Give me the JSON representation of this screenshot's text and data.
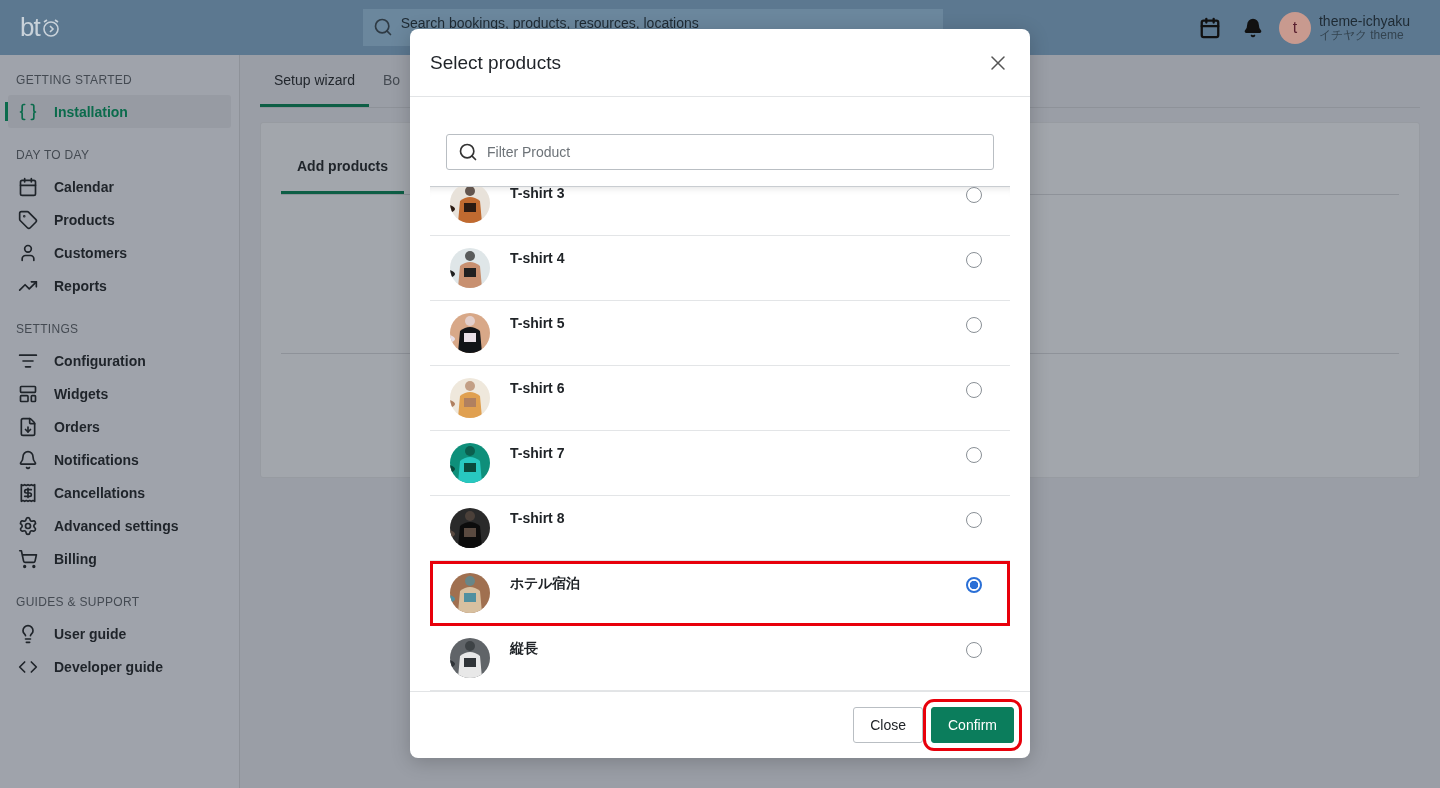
{
  "header": {
    "logo": "bt",
    "search": {
      "placeholder": "Search bookings, products, resources, locations"
    },
    "user": {
      "initial": "t",
      "name": "theme-ichyaku",
      "subtitle": "イチヤク theme"
    }
  },
  "sidebar": {
    "sections": [
      {
        "title": "GETTING STARTED",
        "items": [
          {
            "label": "Installation",
            "selected": true
          }
        ]
      },
      {
        "title": "DAY TO DAY",
        "items": [
          {
            "label": "Calendar",
            "selected": false
          },
          {
            "label": "Products",
            "selected": false
          },
          {
            "label": "Customers",
            "selected": false
          },
          {
            "label": "Reports",
            "selected": false
          }
        ]
      },
      {
        "title": "SETTINGS",
        "items": [
          {
            "label": "Configuration",
            "selected": false
          },
          {
            "label": "Widgets",
            "selected": false
          },
          {
            "label": "Orders",
            "selected": false
          },
          {
            "label": "Notifications",
            "selected": false
          },
          {
            "label": "Cancellations",
            "selected": false
          },
          {
            "label": "Advanced settings",
            "selected": false
          },
          {
            "label": "Billing",
            "selected": false
          }
        ]
      },
      {
        "title": "GUIDES & SUPPORT",
        "items": [
          {
            "label": "User guide",
            "selected": false
          },
          {
            "label": "Developer guide",
            "selected": false
          }
        ]
      }
    ]
  },
  "main": {
    "tabs": [
      {
        "label": "Setup wizard",
        "selected": true
      },
      {
        "label": "Bo",
        "selected": false
      }
    ],
    "card_tabs": [
      {
        "label": "Add products",
        "selected": true
      }
    ]
  },
  "modal": {
    "title": "Select products",
    "filter": {
      "placeholder": "Filter Product"
    },
    "products": [
      {
        "name": "T-shirt 3",
        "selected": false,
        "annotated": false
      },
      {
        "name": "T-shirt 4",
        "selected": false,
        "annotated": false
      },
      {
        "name": "T-shirt 5",
        "selected": false,
        "annotated": false
      },
      {
        "name": "T-shirt 6",
        "selected": false,
        "annotated": false
      },
      {
        "name": "T-shirt 7",
        "selected": false,
        "annotated": false
      },
      {
        "name": "T-shirt 8",
        "selected": false,
        "annotated": false
      },
      {
        "name": "ホテル宿泊",
        "selected": true,
        "annotated": true
      },
      {
        "name": "縦長",
        "selected": false,
        "annotated": false
      }
    ],
    "buttons": [
      {
        "label": "Close",
        "kind": "secondary",
        "annotated": false
      },
      {
        "label": "Confirm",
        "kind": "primary",
        "annotated": true
      }
    ]
  }
}
